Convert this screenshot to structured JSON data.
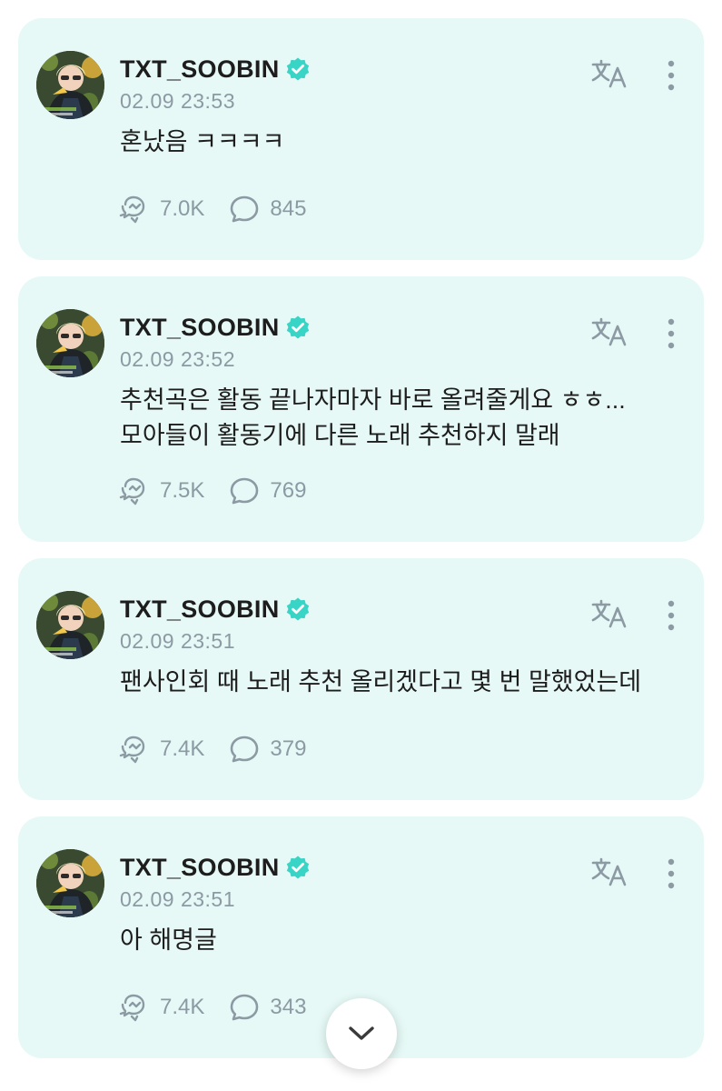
{
  "colors": {
    "card_background": "#e6f9f6",
    "verified_badge": "#38d4c5",
    "icon_gray": "#8c9aa4",
    "text_dark": "#1d1d1d"
  },
  "posts": [
    {
      "author": "TXT_SOOBIN",
      "timestamp": "02.09 23:53",
      "text": "혼났음 ㅋㅋㅋㅋ",
      "comment_count_label": "7.0K",
      "reply_count_label": "845"
    },
    {
      "author": "TXT_SOOBIN",
      "timestamp": "02.09 23:52",
      "text": "추천곡은 활동 끝나자마자 바로 올려줄게요 ㅎㅎ...\n모아들이 활동기에 다른 노래 추천하지 말래",
      "comment_count_label": "7.5K",
      "reply_count_label": "769"
    },
    {
      "author": "TXT_SOOBIN",
      "timestamp": "02.09 23:51",
      "text": "팬사인회 때 노래 추천 올리겠다고 몇 번 말했었는데",
      "comment_count_label": "7.4K",
      "reply_count_label": "379"
    },
    {
      "author": "TXT_SOOBIN",
      "timestamp": "02.09 23:51",
      "text": "아 해명글",
      "comment_count_label": "7.4K",
      "reply_count_label": "343"
    }
  ],
  "icons": {
    "verified": "verified-badge-icon",
    "comment": "comment-icon",
    "reply": "reply-bubble-icon",
    "translate": "translate-icon",
    "more": "more-vertical-icon",
    "scroll_down": "chevron-down-icon"
  }
}
